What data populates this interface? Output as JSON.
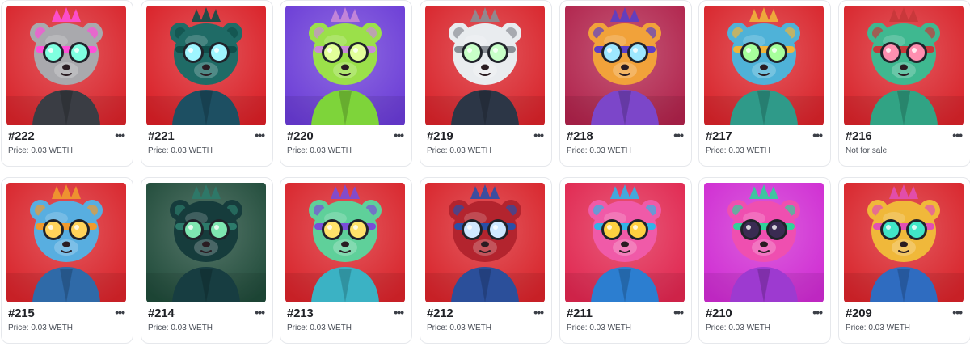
{
  "more_glyph": "•••",
  "items": [
    {
      "id": "#222",
      "price": "Price: 0.03 WETH",
      "bg": "#d8232a",
      "head": "#a9a9ad",
      "accent": "#ff4fd8",
      "eyes": "#7fffe0",
      "body": "#3a3d44",
      "icon": "cat-character-icon"
    },
    {
      "id": "#221",
      "price": "Price: 0.03 WETH",
      "bg": "#d91f26",
      "head": "#1f6b66",
      "accent": "#0f4e4a",
      "eyes": "#9ff6ff",
      "body": "#1d4f62",
      "icon": "punk-bear-character-icon"
    },
    {
      "id": "#220",
      "price": "Price: 0.03 WETH",
      "bg": "#6a3bd6",
      "head": "#9be04a",
      "accent": "#c98ad8",
      "eyes": "#e2ff9a",
      "body": "#7ed43a",
      "icon": "lizard-character-icon"
    },
    {
      "id": "#219",
      "price": "Price: 0.03 WETH",
      "bg": "#d8232a",
      "head": "#e9ecef",
      "accent": "#8a8f96",
      "eyes": "#c8ffc8",
      "body": "#2c3646",
      "icon": "panda-character-icon"
    },
    {
      "id": "#218",
      "price": "Price: 0.03 WETH",
      "bg": "#b0224b",
      "head": "#f1a23a",
      "accent": "#5b3ec7",
      "eyes": "#9ee7ff",
      "body": "#7c46c9",
      "icon": "hero-bear-character-icon"
    },
    {
      "id": "#217",
      "price": "Price: 0.03 WETH",
      "bg": "#d8232a",
      "head": "#4fb2d8",
      "accent": "#f0b43a",
      "eyes": "#a7ff9c",
      "body": "#2f9a89",
      "icon": "hooded-monkey-character-icon"
    },
    {
      "id": "#216",
      "price": "Not for sale",
      "bg": "#d8232a",
      "head": "#3fb890",
      "accent": "#c7373a",
      "eyes": "#ff8fb0",
      "body": "#31a384",
      "icon": "spiky-bear-character-icon"
    },
    {
      "id": "#215",
      "price": "Price: 0.03 WETH",
      "bg": "#d8232a",
      "head": "#58aee0",
      "accent": "#f09a2d",
      "eyes": "#ffd35a",
      "body": "#2f6aa8",
      "icon": "lion-character-icon"
    },
    {
      "id": "#214",
      "price": "Price: 0.03 WETH",
      "bg": "#1f4a39",
      "head": "#163c3c",
      "accent": "#2c7a6a",
      "eyes": "#7ee6b0",
      "body": "#173d41",
      "icon": "hooded-cat-character-icon"
    },
    {
      "id": "#213",
      "price": "Price: 0.03 WETH",
      "bg": "#d8232a",
      "head": "#5fd09a",
      "accent": "#7a4dd8",
      "eyes": "#ffe26a",
      "body": "#3bb2c4",
      "icon": "helmet-bear-character-icon"
    },
    {
      "id": "#212",
      "price": "Price: 0.03 WETH",
      "bg": "#d8232a",
      "head": "#b3242e",
      "accent": "#2a4fa8",
      "eyes": "#cfe8ff",
      "body": "#2b4f9a",
      "icon": "masked-bear-character-icon"
    },
    {
      "id": "#211",
      "price": "Price: 0.03 WETH",
      "bg": "#e0264f",
      "head": "#f05aa8",
      "accent": "#31b4e8",
      "eyes": "#ffd040",
      "body": "#2c7ed0",
      "icon": "duck-character-icon"
    },
    {
      "id": "#210",
      "price": "Price: 0.03 WETH",
      "bg": "#cf2bd2",
      "head": "#ef4fb0",
      "accent": "#2fd39a",
      "eyes": "#3a2b52",
      "body": "#9d3ad0",
      "icon": "masked-pink-bear-character-icon"
    },
    {
      "id": "#209",
      "price": "Price: 0.03 WETH",
      "bg": "#d8232a",
      "head": "#f0b83a",
      "accent": "#e24fb4",
      "eyes": "#40e6c8",
      "body": "#2f6cc0",
      "icon": "punk-bear-goggles-character-icon"
    }
  ]
}
